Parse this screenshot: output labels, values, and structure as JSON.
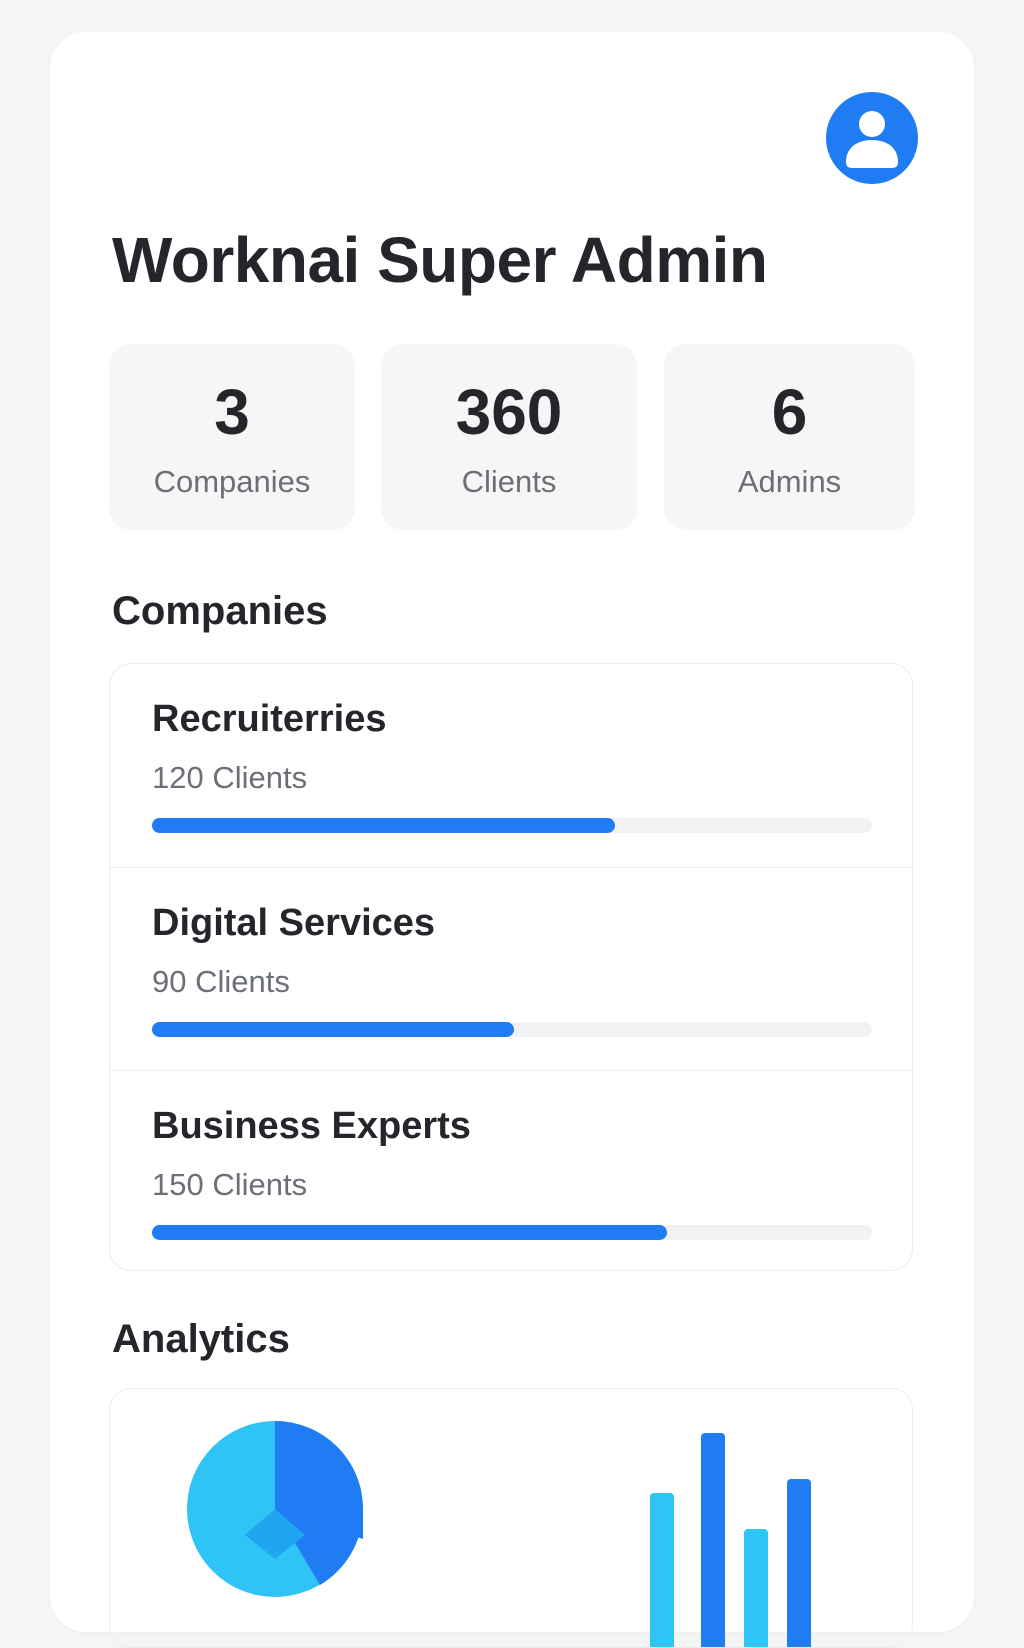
{
  "header": {
    "title": "Worknai Super Admin",
    "avatar_icon": "user-avatar-icon"
  },
  "stats": [
    {
      "value": "3",
      "label": "Companies"
    },
    {
      "value": "360",
      "label": "Clients"
    },
    {
      "value": "6",
      "label": "Admins"
    }
  ],
  "companies": {
    "heading": "Companies",
    "items": [
      {
        "name": "Recruiterries",
        "clients": "120 Clients",
        "progress": 0.643
      },
      {
        "name": "Digital Services",
        "clients": "90 Clients",
        "progress": 0.503
      },
      {
        "name": "Business Experts",
        "clients": "150 Clients",
        "progress": 0.715
      }
    ]
  },
  "analytics": {
    "heading": "Analytics"
  },
  "colors": {
    "accent": "#1f7cf3",
    "accent_light": "#2ec5f6",
    "track": "#f1f2f4"
  }
}
